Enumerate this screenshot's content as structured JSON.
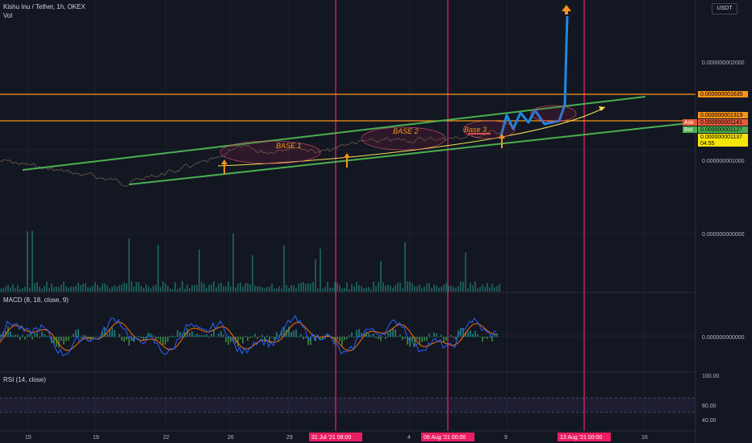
{
  "header": {
    "symbol_title": "Kishu Inu / Tether, 1h, OKEX",
    "vol_label": "Vol",
    "macd_label": "MACD (8, 18, close, 9)",
    "rsi_label": "RSI (14, close)",
    "currency_badge": "USDT"
  },
  "chart_data": {
    "type": "line",
    "title": "Kishu Inu / Tether, 1h, OKEX",
    "price_axis_ticks": [
      "0.000000002000",
      "0.000000001000",
      "0.000000000000"
    ],
    "macd_axis_ticks": [
      "0.000000000000"
    ],
    "rsi_axis_ticks": [
      "100.00",
      "60.00",
      "40.00"
    ],
    "x_ticks": [
      "15",
      "19",
      "22",
      "26",
      "29",
      "4",
      "9",
      "16"
    ],
    "vertical_markers": [
      "31 Jul '21  08:00",
      "06 Aug '21  00:00",
      "13 Aug '21  00:00"
    ],
    "price_tags": [
      {
        "label": "",
        "value": "0.000000001635",
        "color": "#f7931a"
      },
      {
        "label": "",
        "value": "0.000000001319",
        "color": "#f7931a"
      },
      {
        "label": "Ask",
        "value": "0.000000001141",
        "color": "#e55a3a"
      },
      {
        "label": "Bid",
        "value": "0.000000001127",
        "color": "#4caf50"
      },
      {
        "label": "",
        "value": "0.000000001137",
        "sub": "04:55",
        "color": "#f5e50a"
      }
    ],
    "horizontal_levels": [
      1.635e-09,
      1.319e-09
    ],
    "annotations": [
      "BASE 1",
      "BASE 2",
      "Base 3"
    ],
    "colors": {
      "background": "#131722",
      "channel": "#4caf50",
      "level": "#f7931a",
      "marker": "#e91e63",
      "projection": "#1e88e5",
      "macd": "#2962ff",
      "signal": "#ff6d00",
      "hist": "#26a69a"
    }
  }
}
